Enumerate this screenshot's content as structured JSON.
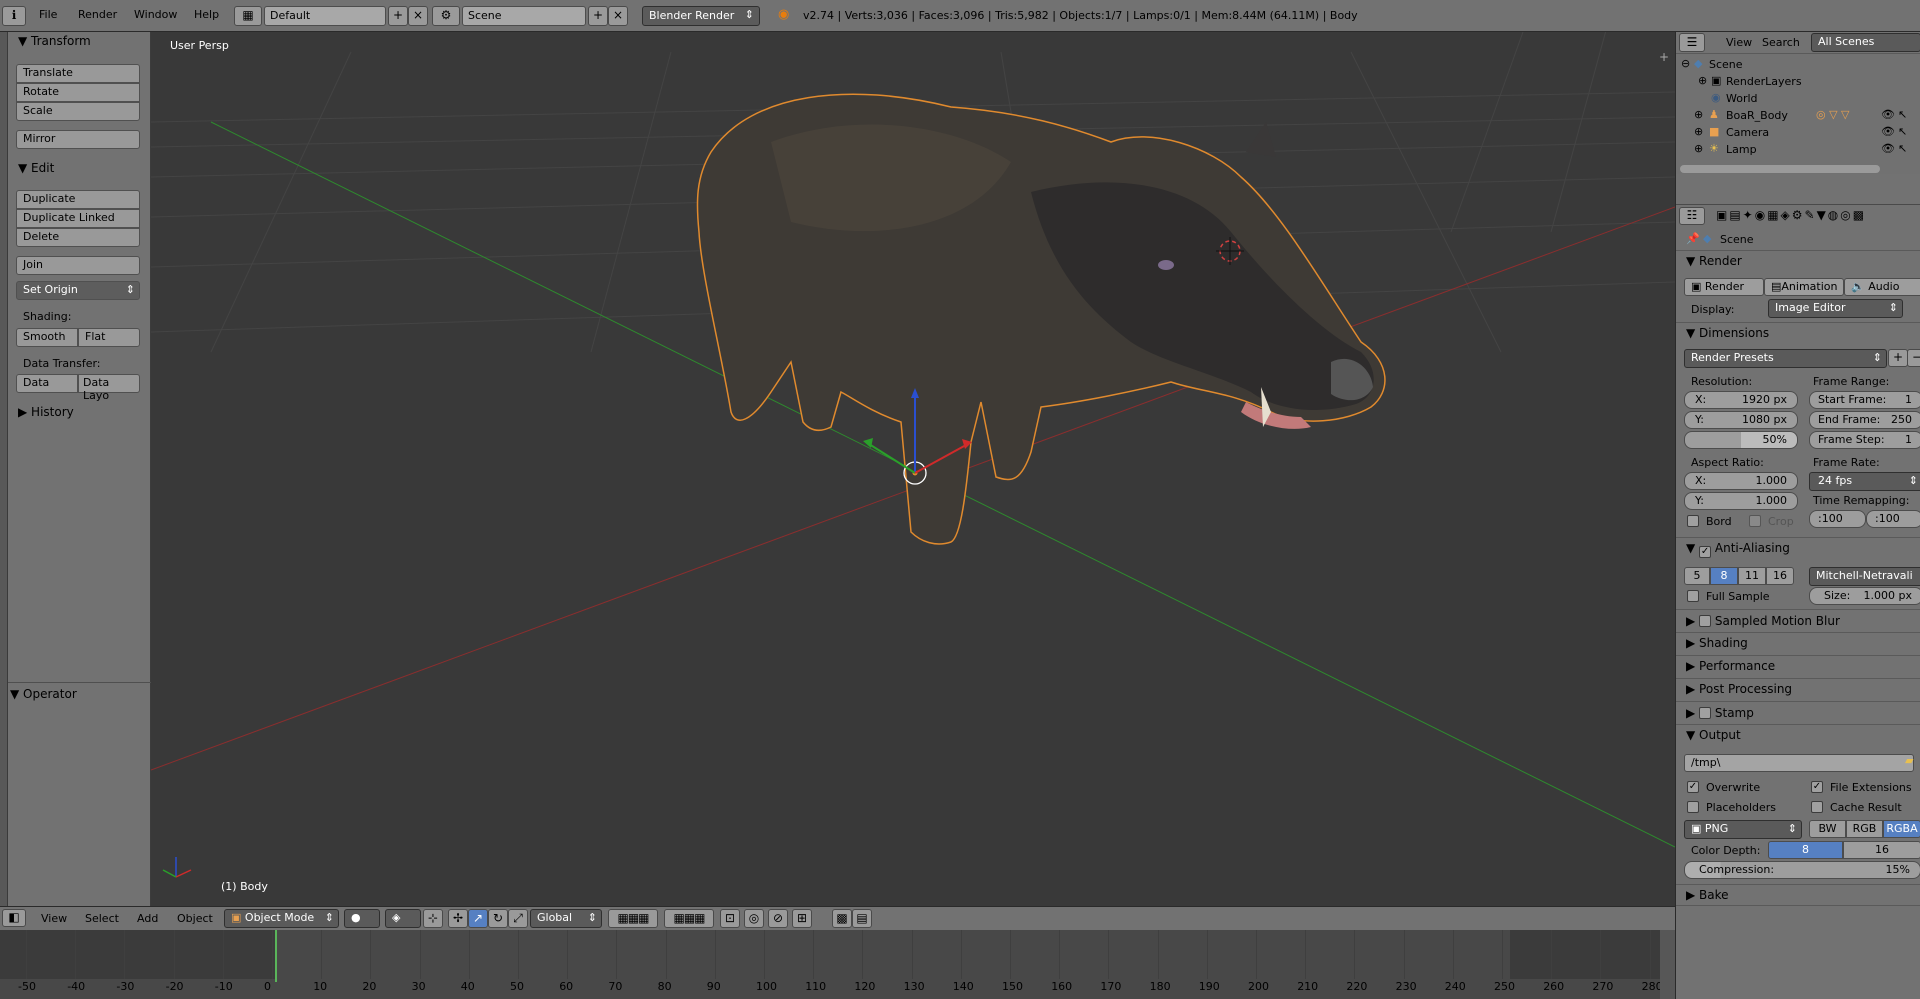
{
  "topbar": {
    "menus": [
      "File",
      "Render",
      "Window",
      "Help"
    ],
    "layout_field": "Default",
    "scene_field": "Scene",
    "engine": "Blender Render",
    "stats": "v2.74 | Verts:3,036 | Faces:3,096 | Tris:5,982 | Objects:1/7 | Lamps:0/1 | Mem:8.44M (64.11M) | Body"
  },
  "toolshelf": {
    "transform_title": "Transform",
    "translate": "Translate",
    "rotate": "Rotate",
    "scale": "Scale",
    "mirror": "Mirror",
    "edit_title": "Edit",
    "duplicate": "Duplicate",
    "duplicate_linked": "Duplicate Linked",
    "delete": "Delete",
    "join": "Join",
    "set_origin": "Set Origin",
    "shading_label": "Shading:",
    "smooth": "Smooth",
    "flat": "Flat",
    "data_transfer_label": "Data Transfer:",
    "data": "Data",
    "data_layo": "Data Layo",
    "history_title": "History",
    "operator_title": "Operator"
  },
  "viewport": {
    "view_label": "User Persp",
    "object_label": "(1) Body"
  },
  "viewheader": {
    "menus": [
      "View",
      "Select",
      "Add",
      "Object"
    ],
    "mode": "Object Mode",
    "orientation": "Global"
  },
  "timeline": {
    "ticks": [
      "-50",
      "-40",
      "-30",
      "-20",
      "-10",
      "0",
      "10",
      "20",
      "30",
      "40",
      "50",
      "60",
      "70",
      "80",
      "90",
      "100",
      "110",
      "120",
      "130",
      "140",
      "150",
      "160",
      "170",
      "180",
      "190",
      "200",
      "210",
      "220",
      "230",
      "240",
      "250",
      "260",
      "270",
      "280"
    ]
  },
  "outliner": {
    "view": "View",
    "search": "Search",
    "filter": "All Scenes",
    "scene": "Scene",
    "renderlayers": "RenderLayers",
    "world": "World",
    "boar": "BoaR_Body",
    "camera": "Camera",
    "lamp": "Lamp"
  },
  "properties": {
    "context": "Scene",
    "render_title": "Render",
    "render_btn": "Render",
    "animation_btn": "Animation",
    "audio_btn": "Audio",
    "display_label": "Display:",
    "display_value": "Image Editor",
    "dimensions_title": "Dimensions",
    "render_presets": "Render Presets",
    "resolution_label": "Resolution:",
    "res_x_label": "X:",
    "res_x": "1920 px",
    "res_y_label": "Y:",
    "res_y": "1080 px",
    "res_pct": "50%",
    "frame_range_label": "Frame Range:",
    "start_label": "Start Frame:",
    "start": "1",
    "end_label": "End Frame:",
    "end": "250",
    "step_label": "Frame Step:",
    "step": "1",
    "aspect_label": "Aspect Ratio:",
    "asp_x": "1.000",
    "asp_y": "1.000",
    "frame_rate_label": "Frame Rate:",
    "fps": "24 fps",
    "time_remap_label": "Time Remapping:",
    "remap_old": "100",
    "remap_new": "100",
    "bord": "Bord",
    "crop": "Crop",
    "aa_title": "Anti-Aliasing",
    "aa_samples": [
      "5",
      "8",
      "11",
      "16"
    ],
    "aa_filter": "Mitchell-Netravali",
    "full_sample": "Full Sample",
    "size_label": "Size:",
    "size_value": "1.000 px",
    "motion_blur": "Sampled Motion Blur",
    "shading": "Shading",
    "performance": "Performance",
    "post_processing": "Post Processing",
    "stamp": "Stamp",
    "output_title": "Output",
    "output_path": "/tmp\\",
    "overwrite": "Overwrite",
    "file_ext": "File Extensions",
    "placeholders": "Placeholders",
    "cache_result": "Cache Result",
    "format": "PNG",
    "bw": "BW",
    "rgb": "RGB",
    "rgba": "RGBA",
    "color_depth_label": "Color Depth:",
    "depth_8": "8",
    "depth_16": "16",
    "compression_label": "Compression:",
    "compression": "15%",
    "bake": "Bake"
  }
}
